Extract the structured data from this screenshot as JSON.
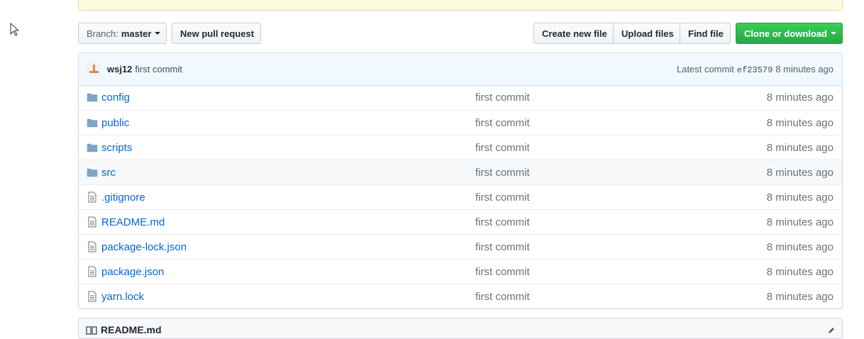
{
  "toolbar": {
    "branch_prefix": "Branch:",
    "branch_name": "master",
    "new_pr_label": "New pull request",
    "create_file_label": "Create new file",
    "upload_label": "Upload files",
    "find_label": "Find file",
    "clone_label": "Clone or download",
    "clone_color": "#28a745"
  },
  "commit": {
    "author": "wsj12",
    "message": "first commit",
    "latest_prefix": "Latest commit",
    "sha": "ef23579",
    "age": "8 minutes ago"
  },
  "files": [
    {
      "type": "folder",
      "icon": "folder-icon",
      "name": "config",
      "message": "first commit",
      "age": "8 minutes ago"
    },
    {
      "type": "folder",
      "icon": "folder-icon",
      "name": "public",
      "message": "first commit",
      "age": "8 minutes ago"
    },
    {
      "type": "folder",
      "icon": "folder-icon",
      "name": "scripts",
      "message": "first commit",
      "age": "8 minutes ago"
    },
    {
      "type": "folder",
      "icon": "folder-icon",
      "name": "src",
      "message": "first commit",
      "age": "8 minutes ago"
    },
    {
      "type": "file",
      "icon": "file-icon",
      "name": ".gitignore",
      "message": "first commit",
      "age": "8 minutes ago"
    },
    {
      "type": "file",
      "icon": "file-icon",
      "name": "README.md",
      "message": "first commit",
      "age": "8 minutes ago"
    },
    {
      "type": "file",
      "icon": "file-icon",
      "name": "package-lock.json",
      "message": "first commit",
      "age": "8 minutes ago"
    },
    {
      "type": "file",
      "icon": "file-icon",
      "name": "package.json",
      "message": "first commit",
      "age": "8 minutes ago"
    },
    {
      "type": "file",
      "icon": "file-icon",
      "name": "yarn.lock",
      "message": "first commit",
      "age": "8 minutes ago"
    }
  ],
  "readme": {
    "label": "README.md"
  }
}
